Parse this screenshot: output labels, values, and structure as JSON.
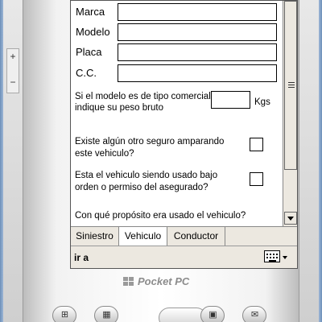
{
  "form": {
    "fields": [
      {
        "label": "Marca",
        "value": ""
      },
      {
        "label": "Modelo",
        "value": ""
      },
      {
        "label": "Placa",
        "value": ""
      },
      {
        "label": "C.C.",
        "value": ""
      }
    ],
    "weight_question_line1": "Si el modelo es de tipo comercial",
    "weight_question_line2": "indique su peso bruto",
    "weight_unit": "Kgs",
    "insurance_question_line1": "Existe algún otro seguro amparando",
    "insurance_question_line2": "este vehiculo?",
    "usage_question_line1": "Esta el vehiculo siendo usado bajo",
    "usage_question_line2": "orden o permiso del asegurado?",
    "purpose_question": "Con qué propósito era usado el vehiculo?"
  },
  "tabs": [
    {
      "label": "Siniestro",
      "active": false
    },
    {
      "label": "Vehiculo",
      "active": true
    },
    {
      "label": "Conductor",
      "active": false
    }
  ],
  "input_bar": {
    "text": "ir a"
  },
  "side_buttons": {
    "plus": "+",
    "minus": "−"
  },
  "brand": {
    "label": "Pocket PC"
  },
  "icons": {
    "keyboard": "keyboard-icon",
    "scroll_down": "chevron-down-icon",
    "hardware_buttons": [
      "windows-icon",
      "calendar-icon",
      "nav-pad",
      "contacts-icon",
      "mail-icon"
    ]
  },
  "colors": {
    "chrome": "#ece8e0",
    "screen": "#ffffff",
    "frame": "#6c8fb8"
  }
}
